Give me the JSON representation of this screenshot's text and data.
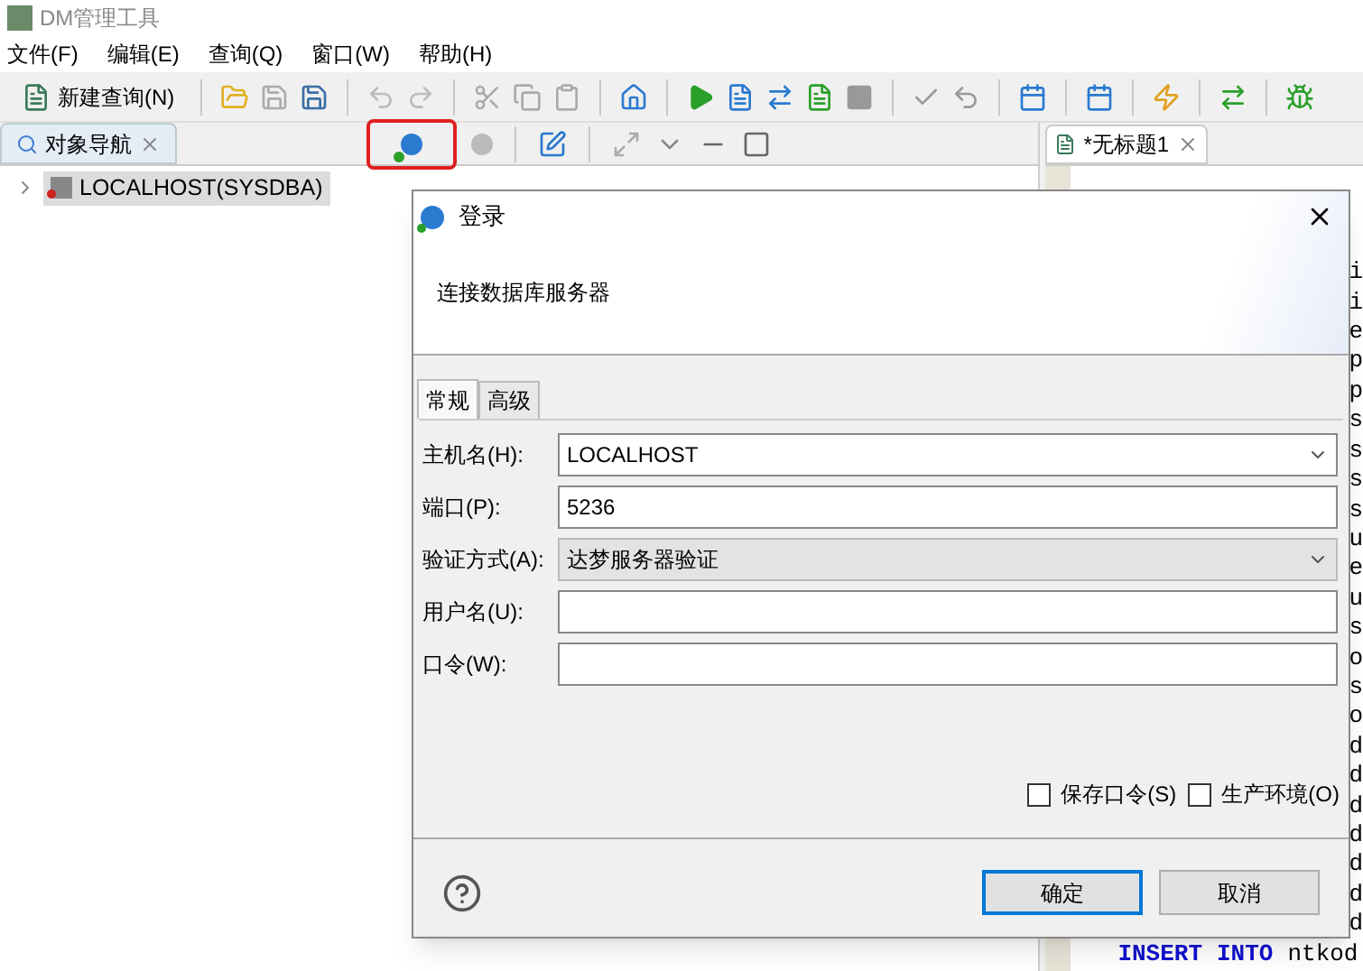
{
  "window": {
    "title": "DM管理工具"
  },
  "menu": [
    "文件(F)",
    "编辑(E)",
    "查询(Q)",
    "窗口(W)",
    "帮助(H)"
  ],
  "toolbar": {
    "new_query": "新建查询(N)"
  },
  "navigator": {
    "tab": "对象导航",
    "tree": [
      {
        "label": "LOCALHOST(SYSDBA)",
        "expanded": false,
        "selected": true
      }
    ]
  },
  "editor": {
    "tab": "*无标题1",
    "lines": [
      "i",
      "i",
      "e",
      "p",
      "p",
      "s",
      "s",
      "s",
      "s",
      "u",
      "e",
      "u",
      "s",
      "o",
      "s",
      "o",
      "d",
      "d",
      "d",
      "d",
      "d",
      "d",
      "d"
    ],
    "last_line": [
      {
        "text": "INSERT",
        "kind": "keyword"
      },
      {
        "text": "INTO",
        "kind": "keyword"
      },
      {
        "text": "ntkod",
        "kind": "plain"
      }
    ]
  },
  "dialog": {
    "title": "登录",
    "subtitle": "连接数据库服务器",
    "tabs": [
      {
        "label": "常规",
        "selected": true
      },
      {
        "label": "高级",
        "selected": false
      }
    ],
    "fields": [
      {
        "label": "主机名(H):",
        "kind": "combo",
        "value": "LOCALHOST",
        "disabled": false
      },
      {
        "label": "端口(P):",
        "kind": "text",
        "value": "5236",
        "disabled": false
      },
      {
        "label": "验证方式(A):",
        "kind": "combo",
        "value": "达梦服务器验证",
        "disabled": true
      },
      {
        "label": "用户名(U):",
        "kind": "text",
        "disabled": false
      },
      {
        "label": "口令(W):",
        "kind": "text",
        "disabled": false
      }
    ],
    "checkboxes": [
      {
        "label": "保存口令(S)",
        "checked": false
      },
      {
        "label": "生产环境(O)",
        "checked": false
      }
    ],
    "buttons": [
      {
        "label": "确定",
        "kind": "primary"
      },
      {
        "label": "取消",
        "kind": "normal"
      }
    ]
  }
}
